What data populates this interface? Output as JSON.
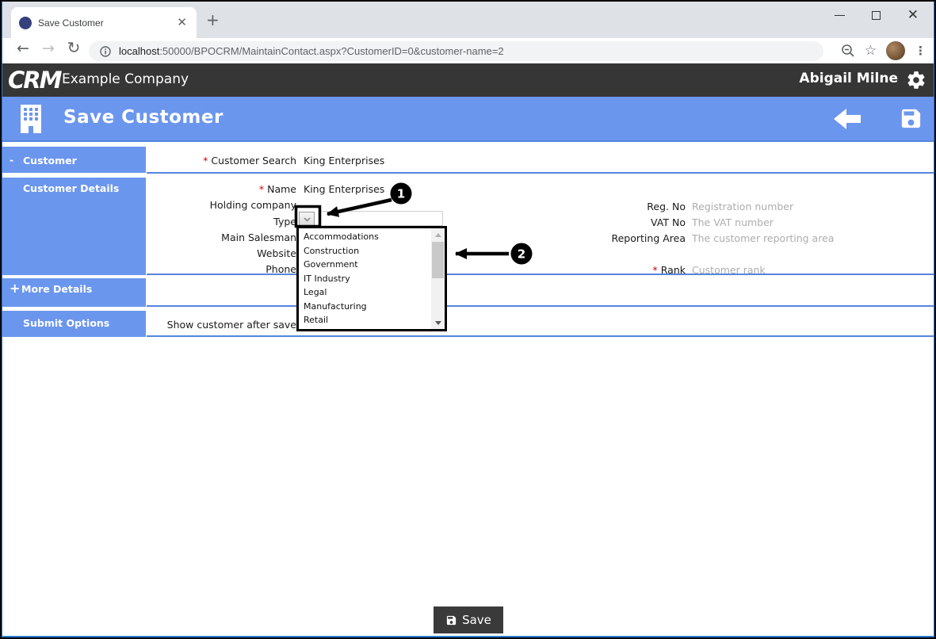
{
  "browser": {
    "tab_title": "Save Customer",
    "new_tab": "+",
    "url_host": "localhost",
    "url_path": ":50000/BPOCRM/MaintainContact.aspx?CustomerID=0&customer-name=2"
  },
  "header": {
    "logo": "CRM",
    "company": "Example Company",
    "user": "Abigail Milne"
  },
  "page": {
    "title": "Save Customer"
  },
  "sidebar": {
    "items": [
      {
        "marker": "-",
        "label": "Customer"
      },
      {
        "marker": "",
        "label": "Customer Details"
      },
      {
        "marker": "+",
        "label": "More Details"
      },
      {
        "marker": "",
        "label": "Submit Options"
      }
    ]
  },
  "form": {
    "required_marker": "*",
    "customer_search": {
      "label": "Customer Search",
      "value": "King Enterprises"
    },
    "name": {
      "label": "Name",
      "value": "King Enterprises"
    },
    "holding_company": {
      "label": "Holding company",
      "value": "-"
    },
    "type": {
      "label": "Type"
    },
    "main_salesman": {
      "label": "Main Salesman"
    },
    "website": {
      "label": "Website"
    },
    "phone": {
      "label": "Phone"
    },
    "reg_no": {
      "label": "Reg. No",
      "placeholder": "Registration number"
    },
    "vat_no": {
      "label": "VAT No",
      "placeholder": "The VAT number"
    },
    "reporting_area": {
      "label": "Reporting Area",
      "placeholder": "The customer reporting area"
    },
    "rank": {
      "label": "Rank",
      "placeholder": "Customer rank"
    },
    "submit_option": "Show customer after save"
  },
  "type_dropdown": {
    "options": [
      "Accommodations",
      "Construction",
      "Government",
      "IT Industry",
      "Legal",
      "Manufacturing",
      "Retail"
    ]
  },
  "annotations": {
    "step1": "1",
    "step2": "2"
  },
  "actions": {
    "save": "Save"
  },
  "colors": {
    "accent_blue": "#6b96ee",
    "divider_blue": "#5585dd",
    "header_dark": "#363636",
    "required_red": "#d40000",
    "annotation_black": "#000000"
  }
}
